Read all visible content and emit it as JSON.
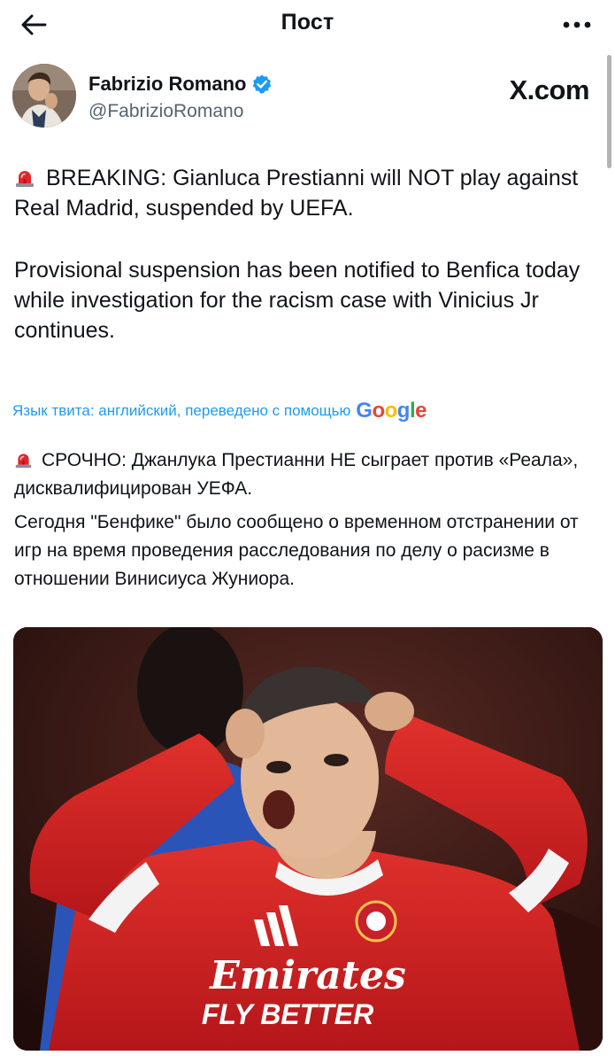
{
  "header": {
    "title": "Пост"
  },
  "author": {
    "name": "Fabrizio Romano",
    "handle": "@FabrizioRomano",
    "source_badge": "X.com"
  },
  "tweet": {
    "paragraph1": "BREAKING: Gianluca Prestianni will NOT play against Real Madrid, suspended by UEFA.",
    "paragraph2": "Provisional suspension has been notified to Benfica today while investigation for the racism case with Vinicius Jr continues."
  },
  "translation": {
    "label": "Язык твита: английский, переведено с помощью",
    "provider": "Google",
    "provider_colors": [
      "#4285F4",
      "#EA4335",
      "#FBBC05",
      "#4285F4",
      "#34A853",
      "#EA4335"
    ],
    "paragraph1": "СРОЧНО: Джанлука Престианни НЕ сыграет против «Реала», дисквалифицирован УЕФА.",
    "paragraph2": "Сегодня \"Бенфике\" было сообщено о временном отстранении от игр на время проведения расследования по делу о расизме в отношении Винисиуса Жуниора."
  },
  "media": {
    "shirt_sponsor_line1": "Emirates",
    "shirt_sponsor_line2": "FLY BETTER"
  },
  "icons": {
    "back": "arrow-left-icon",
    "more": "more-horizontal-icon",
    "verified": "verified-badge-icon",
    "siren": "rotating-light-icon"
  },
  "colors": {
    "link": "#1d9bf0",
    "verified": "#1d9bf0",
    "muted_text": "#536471",
    "jersey_red": "#d6201f"
  }
}
